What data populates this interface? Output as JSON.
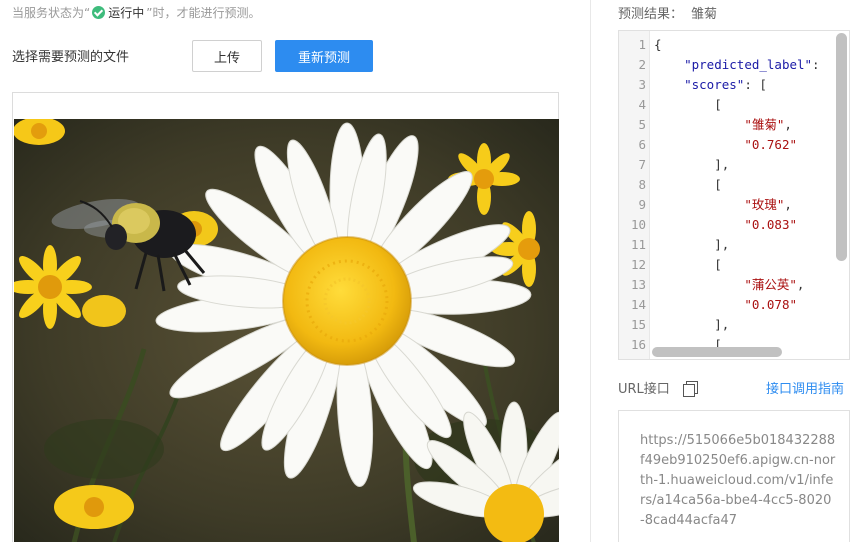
{
  "status": {
    "prefix": "当服务状态为“",
    "running_label": "运行中",
    "suffix": "”时，才能进行预测。"
  },
  "upload_section": {
    "file_label": "选择需要预测的文件",
    "upload_button": "上传",
    "repredict_button": "重新预测"
  },
  "result": {
    "title": "预测结果：",
    "predicted_value": "雏菊",
    "code_lines": [
      {
        "n": "1",
        "text": "{"
      },
      {
        "n": "2",
        "text": "    \"predicted_label\":"
      },
      {
        "n": "3",
        "text": "    \"scores\": ["
      },
      {
        "n": "4",
        "text": "        ["
      },
      {
        "n": "5",
        "text": "            \"雏菊\","
      },
      {
        "n": "6",
        "text": "            \"0.762\""
      },
      {
        "n": "7",
        "text": "        ],"
      },
      {
        "n": "8",
        "text": "        ["
      },
      {
        "n": "9",
        "text": "            \"玫瑰\","
      },
      {
        "n": "10",
        "text": "            \"0.083\""
      },
      {
        "n": "11",
        "text": "        ],"
      },
      {
        "n": "12",
        "text": "        ["
      },
      {
        "n": "13",
        "text": "            \"蒲公英\","
      },
      {
        "n": "14",
        "text": "            \"0.078\""
      },
      {
        "n": "15",
        "text": "        ],"
      },
      {
        "n": "16",
        "text": "        ["
      }
    ]
  },
  "api": {
    "url_label": "URL接口",
    "guide_link": "接口调用指南",
    "url_text": "https://515066e5b018432288f49eb910250ef6.apigw.cn-north-1.huaweicloud.com/v1/infers/a14ca56a-bbe4-4cc5-8020-8cad44acfa47"
  },
  "colors": {
    "primary": "#2d8cf0",
    "success": "#3ebc7c",
    "petal": "#ffffff",
    "flower_center": "#f5c518"
  },
  "icons": {
    "status": "check-circle-icon",
    "copy": "copy-icon"
  }
}
